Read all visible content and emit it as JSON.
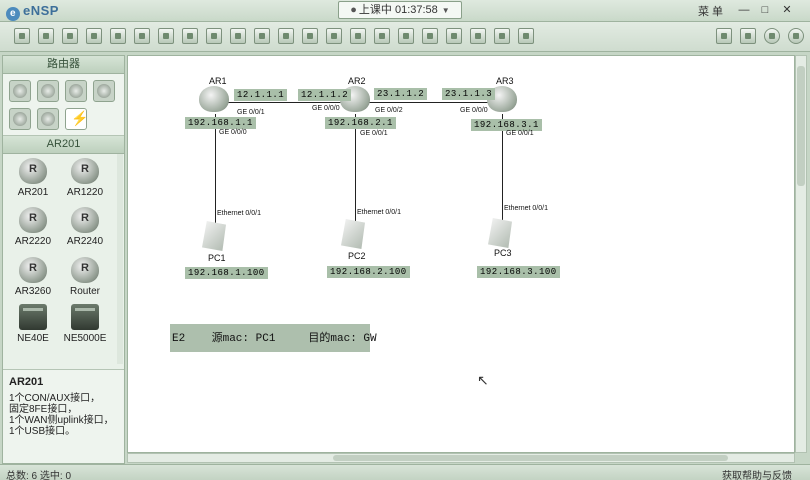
{
  "titlebar": {
    "app_name": "eNSP",
    "session": "上课中 01:37:58",
    "menu_label": "菜 单",
    "minimize": "—",
    "maximize": "□",
    "close": "✕"
  },
  "left_panel": {
    "category_header": "路由器",
    "device_header": "AR201",
    "devices": [
      {
        "label": "AR201",
        "icon": "router-icon"
      },
      {
        "label": "AR1220",
        "icon": "router-icon"
      },
      {
        "label": "AR2220",
        "icon": "router-icon"
      },
      {
        "label": "AR2240",
        "icon": "router-icon"
      },
      {
        "label": "AR3260",
        "icon": "router-icon"
      },
      {
        "label": "Router",
        "icon": "router-icon"
      },
      {
        "label": "NE40E",
        "icon": "chassis-icon"
      },
      {
        "label": "NE5000E",
        "icon": "chassis-icon"
      }
    ],
    "description": {
      "title": "AR201",
      "lines": [
        "1个CON/AUX接口，",
        "固定8FE接口，",
        "1个WAN侧uplink接口，",
        "1个USB接口。"
      ]
    }
  },
  "topology": {
    "nodes": [
      {
        "id": "AR1",
        "label": "AR1",
        "type": "router"
      },
      {
        "id": "AR2",
        "label": "AR2",
        "type": "router"
      },
      {
        "id": "AR3",
        "label": "AR3",
        "type": "router"
      },
      {
        "id": "PC1",
        "label": "PC1",
        "type": "pc"
      },
      {
        "id": "PC2",
        "label": "PC2",
        "type": "pc"
      },
      {
        "id": "PC3",
        "label": "PC3",
        "type": "pc"
      }
    ],
    "ip_labels": {
      "ar1_wan": "12.1.1.1",
      "ar2_wan_left": "12.1.1.2",
      "ar2_wan_right": "23.1.1.2",
      "ar3_wan": "23.1.1.3",
      "ar1_lan": "192.168.1.1",
      "ar2_lan": "192.168.2.1",
      "ar3_lan": "192.168.3.1",
      "pc1_ip": "192.168.1.100",
      "pc2_ip": "192.168.2.100",
      "pc3_ip": "192.168.3.100"
    },
    "port_labels": {
      "ar1_ge001": "GE 0/0/1",
      "ar1_ge000": "GE 0/0/0",
      "ar2_ge000": "GE 0/0/0",
      "ar2_ge002": "GE 0/0/2",
      "ar2_ge001": "GE 0/0/1",
      "ar3_ge000": "GE 0/0/0",
      "ar3_ge001": "GE 0/0/1",
      "pc1_eth": "Ethernet 0/0/1",
      "pc2_eth": "Ethernet 0/0/1",
      "pc3_eth": "Ethernet 0/0/1"
    },
    "note": "E2    源mac: PC1     目的mac: GW"
  },
  "statusbar": {
    "left": "总数: 6 选中: 0",
    "right": "获取帮助与反馈"
  }
}
